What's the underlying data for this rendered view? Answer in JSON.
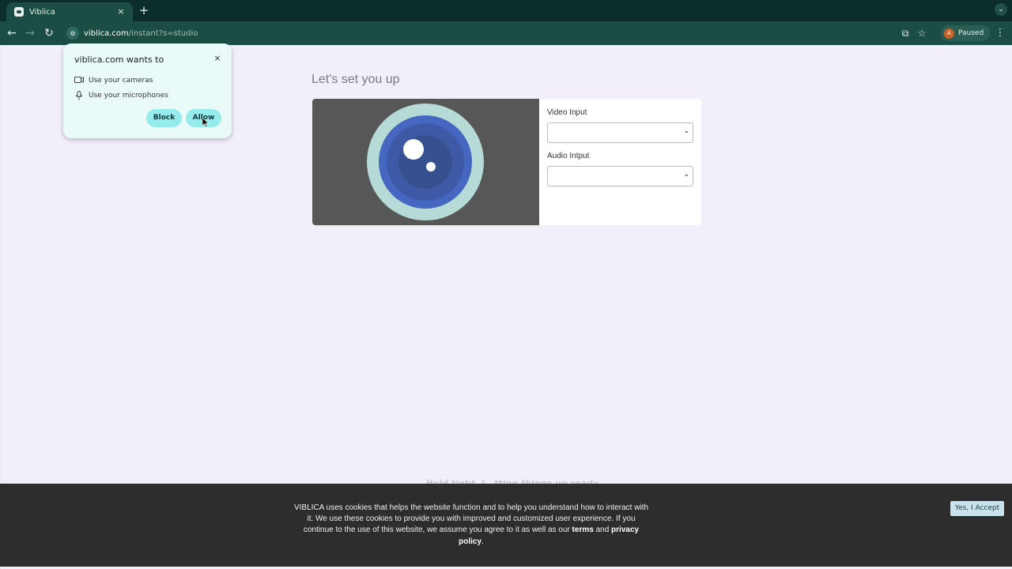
{
  "browser": {
    "tab": {
      "title": "Viblica",
      "close": "×"
    },
    "new_tab": "+",
    "url": {
      "host": "viblica.com",
      "path": "/instant?s=studio"
    },
    "profile": {
      "initial": "A",
      "label": "Paused"
    }
  },
  "page": {
    "title": "Let's set you up",
    "video_input_label": "Video Input",
    "audio_input_label": "Audio Intput",
    "obscured_text": "Hold tight, I  ..tting things up ready"
  },
  "permission_popup": {
    "title": "viblica.com wants to",
    "close": "×",
    "items": [
      {
        "label": "Use your cameras",
        "icon": "camera-icon"
      },
      {
        "label": "Use your microphones",
        "icon": "microphone-icon"
      }
    ],
    "block_label": "Block",
    "allow_label": "Allow"
  },
  "cookie_banner": {
    "text": "VIBLICA uses cookies that helps the website function and to help you understand how to interact with it. We use these cookies to provide you with improved and customized user experience. If you continue to the use of this website, we assume you agree to it as well as our",
    "terms": "terms",
    "and": "and",
    "privacy": "privacy policy",
    "period": ".",
    "accept_label": "Yes, I Accept"
  },
  "colors": {
    "chrome_dark": "#0c2e2a",
    "chrome_toolbar": "#1b4d44",
    "page_bg": "#f3effa",
    "preview_bg": "#575757",
    "lens_outer": "#b6dad6",
    "lens_ring": "#4567c2",
    "popup_button": "#96ecec",
    "cookie_bg": "#2d2d2d"
  }
}
